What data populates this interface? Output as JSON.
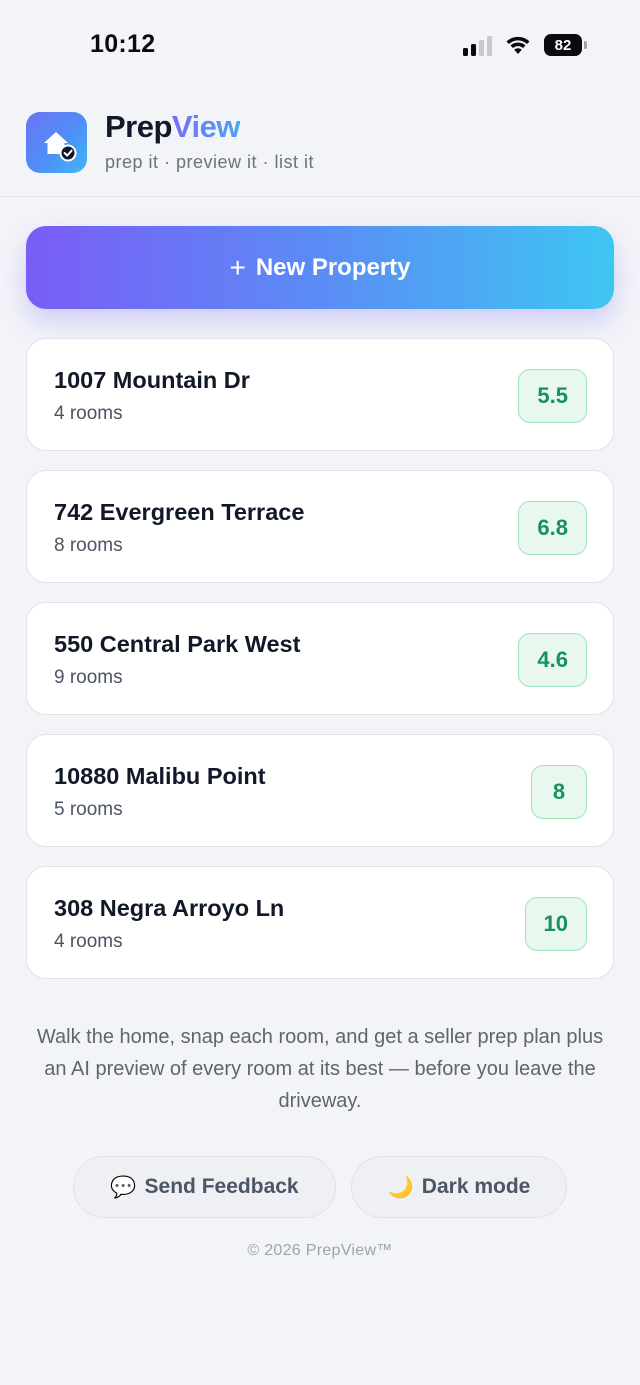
{
  "status_bar": {
    "time": "10:12",
    "battery": "82"
  },
  "app": {
    "name_part_a": "Prep",
    "name_part_b": "View",
    "tagline": "prep it · preview it · list it"
  },
  "new_property_button": {
    "icon": "+",
    "label": "New Property"
  },
  "properties": [
    {
      "name": "1007 Mountain Dr",
      "rooms": "4 rooms",
      "score": "5.5"
    },
    {
      "name": "742 Evergreen Terrace",
      "rooms": "8 rooms",
      "score": "6.8"
    },
    {
      "name": "550 Central Park West",
      "rooms": "9 rooms",
      "score": "4.6"
    },
    {
      "name": "10880 Malibu Point",
      "rooms": "5 rooms",
      "score": "8"
    },
    {
      "name": "308 Negra Arroyo Ln",
      "rooms": "4 rooms",
      "score": "10"
    }
  ],
  "description": "Walk the home, snap each room, and get a seller prep plan plus an AI preview of every room at its best — before you leave the driveway.",
  "footer": {
    "feedback_icon": "💬",
    "feedback_label": "Send Feedback",
    "dark_icon": "🌙",
    "dark_label": "Dark mode",
    "copyright": "© 2026 PrepView™"
  },
  "colors": {
    "accent_purple": "#7a5cf7",
    "accent_cyan": "#3ec6f2",
    "score_green": "#15935a",
    "score_bg": "#e8f8ef",
    "page_bg": "#f3f4f8"
  },
  "icons": [
    "signal-icon",
    "wifi-icon",
    "battery-icon",
    "house-check-icon",
    "speech-bubble-icon",
    "moon-icon"
  ]
}
